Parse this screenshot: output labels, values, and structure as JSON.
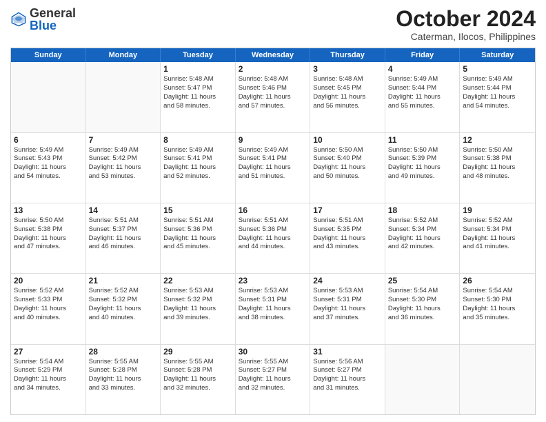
{
  "logo": {
    "general": "General",
    "blue": "Blue"
  },
  "title": "October 2024",
  "subtitle": "Caterman, Ilocos, Philippines",
  "header_days": [
    "Sunday",
    "Monday",
    "Tuesday",
    "Wednesday",
    "Thursday",
    "Friday",
    "Saturday"
  ],
  "weeks": [
    [
      {
        "day": "",
        "sunrise": "",
        "sunset": "",
        "daylight": "",
        "empty": true
      },
      {
        "day": "",
        "sunrise": "",
        "sunset": "",
        "daylight": "",
        "empty": true
      },
      {
        "day": "1",
        "sunrise": "Sunrise: 5:48 AM",
        "sunset": "Sunset: 5:47 PM",
        "daylight": "Daylight: 11 hours",
        "daylight2": "and 58 minutes.",
        "empty": false
      },
      {
        "day": "2",
        "sunrise": "Sunrise: 5:48 AM",
        "sunset": "Sunset: 5:46 PM",
        "daylight": "Daylight: 11 hours",
        "daylight2": "and 57 minutes.",
        "empty": false
      },
      {
        "day": "3",
        "sunrise": "Sunrise: 5:48 AM",
        "sunset": "Sunset: 5:45 PM",
        "daylight": "Daylight: 11 hours",
        "daylight2": "and 56 minutes.",
        "empty": false
      },
      {
        "day": "4",
        "sunrise": "Sunrise: 5:49 AM",
        "sunset": "Sunset: 5:44 PM",
        "daylight": "Daylight: 11 hours",
        "daylight2": "and 55 minutes.",
        "empty": false
      },
      {
        "day": "5",
        "sunrise": "Sunrise: 5:49 AM",
        "sunset": "Sunset: 5:44 PM",
        "daylight": "Daylight: 11 hours",
        "daylight2": "and 54 minutes.",
        "empty": false
      }
    ],
    [
      {
        "day": "6",
        "sunrise": "Sunrise: 5:49 AM",
        "sunset": "Sunset: 5:43 PM",
        "daylight": "Daylight: 11 hours",
        "daylight2": "and 54 minutes.",
        "empty": false
      },
      {
        "day": "7",
        "sunrise": "Sunrise: 5:49 AM",
        "sunset": "Sunset: 5:42 PM",
        "daylight": "Daylight: 11 hours",
        "daylight2": "and 53 minutes.",
        "empty": false
      },
      {
        "day": "8",
        "sunrise": "Sunrise: 5:49 AM",
        "sunset": "Sunset: 5:41 PM",
        "daylight": "Daylight: 11 hours",
        "daylight2": "and 52 minutes.",
        "empty": false
      },
      {
        "day": "9",
        "sunrise": "Sunrise: 5:49 AM",
        "sunset": "Sunset: 5:41 PM",
        "daylight": "Daylight: 11 hours",
        "daylight2": "and 51 minutes.",
        "empty": false
      },
      {
        "day": "10",
        "sunrise": "Sunrise: 5:50 AM",
        "sunset": "Sunset: 5:40 PM",
        "daylight": "Daylight: 11 hours",
        "daylight2": "and 50 minutes.",
        "empty": false
      },
      {
        "day": "11",
        "sunrise": "Sunrise: 5:50 AM",
        "sunset": "Sunset: 5:39 PM",
        "daylight": "Daylight: 11 hours",
        "daylight2": "and 49 minutes.",
        "empty": false
      },
      {
        "day": "12",
        "sunrise": "Sunrise: 5:50 AM",
        "sunset": "Sunset: 5:38 PM",
        "daylight": "Daylight: 11 hours",
        "daylight2": "and 48 minutes.",
        "empty": false
      }
    ],
    [
      {
        "day": "13",
        "sunrise": "Sunrise: 5:50 AM",
        "sunset": "Sunset: 5:38 PM",
        "daylight": "Daylight: 11 hours",
        "daylight2": "and 47 minutes.",
        "empty": false
      },
      {
        "day": "14",
        "sunrise": "Sunrise: 5:51 AM",
        "sunset": "Sunset: 5:37 PM",
        "daylight": "Daylight: 11 hours",
        "daylight2": "and 46 minutes.",
        "empty": false
      },
      {
        "day": "15",
        "sunrise": "Sunrise: 5:51 AM",
        "sunset": "Sunset: 5:36 PM",
        "daylight": "Daylight: 11 hours",
        "daylight2": "and 45 minutes.",
        "empty": false
      },
      {
        "day": "16",
        "sunrise": "Sunrise: 5:51 AM",
        "sunset": "Sunset: 5:36 PM",
        "daylight": "Daylight: 11 hours",
        "daylight2": "and 44 minutes.",
        "empty": false
      },
      {
        "day": "17",
        "sunrise": "Sunrise: 5:51 AM",
        "sunset": "Sunset: 5:35 PM",
        "daylight": "Daylight: 11 hours",
        "daylight2": "and 43 minutes.",
        "empty": false
      },
      {
        "day": "18",
        "sunrise": "Sunrise: 5:52 AM",
        "sunset": "Sunset: 5:34 PM",
        "daylight": "Daylight: 11 hours",
        "daylight2": "and 42 minutes.",
        "empty": false
      },
      {
        "day": "19",
        "sunrise": "Sunrise: 5:52 AM",
        "sunset": "Sunset: 5:34 PM",
        "daylight": "Daylight: 11 hours",
        "daylight2": "and 41 minutes.",
        "empty": false
      }
    ],
    [
      {
        "day": "20",
        "sunrise": "Sunrise: 5:52 AM",
        "sunset": "Sunset: 5:33 PM",
        "daylight": "Daylight: 11 hours",
        "daylight2": "and 40 minutes.",
        "empty": false
      },
      {
        "day": "21",
        "sunrise": "Sunrise: 5:52 AM",
        "sunset": "Sunset: 5:32 PM",
        "daylight": "Daylight: 11 hours",
        "daylight2": "and 40 minutes.",
        "empty": false
      },
      {
        "day": "22",
        "sunrise": "Sunrise: 5:53 AM",
        "sunset": "Sunset: 5:32 PM",
        "daylight": "Daylight: 11 hours",
        "daylight2": "and 39 minutes.",
        "empty": false
      },
      {
        "day": "23",
        "sunrise": "Sunrise: 5:53 AM",
        "sunset": "Sunset: 5:31 PM",
        "daylight": "Daylight: 11 hours",
        "daylight2": "and 38 minutes.",
        "empty": false
      },
      {
        "day": "24",
        "sunrise": "Sunrise: 5:53 AM",
        "sunset": "Sunset: 5:31 PM",
        "daylight": "Daylight: 11 hours",
        "daylight2": "and 37 minutes.",
        "empty": false
      },
      {
        "day": "25",
        "sunrise": "Sunrise: 5:54 AM",
        "sunset": "Sunset: 5:30 PM",
        "daylight": "Daylight: 11 hours",
        "daylight2": "and 36 minutes.",
        "empty": false
      },
      {
        "day": "26",
        "sunrise": "Sunrise: 5:54 AM",
        "sunset": "Sunset: 5:30 PM",
        "daylight": "Daylight: 11 hours",
        "daylight2": "and 35 minutes.",
        "empty": false
      }
    ],
    [
      {
        "day": "27",
        "sunrise": "Sunrise: 5:54 AM",
        "sunset": "Sunset: 5:29 PM",
        "daylight": "Daylight: 11 hours",
        "daylight2": "and 34 minutes.",
        "empty": false
      },
      {
        "day": "28",
        "sunrise": "Sunrise: 5:55 AM",
        "sunset": "Sunset: 5:28 PM",
        "daylight": "Daylight: 11 hours",
        "daylight2": "and 33 minutes.",
        "empty": false
      },
      {
        "day": "29",
        "sunrise": "Sunrise: 5:55 AM",
        "sunset": "Sunset: 5:28 PM",
        "daylight": "Daylight: 11 hours",
        "daylight2": "and 32 minutes.",
        "empty": false
      },
      {
        "day": "30",
        "sunrise": "Sunrise: 5:55 AM",
        "sunset": "Sunset: 5:27 PM",
        "daylight": "Daylight: 11 hours",
        "daylight2": "and 32 minutes.",
        "empty": false
      },
      {
        "day": "31",
        "sunrise": "Sunrise: 5:56 AM",
        "sunset": "Sunset: 5:27 PM",
        "daylight": "Daylight: 11 hours",
        "daylight2": "and 31 minutes.",
        "empty": false
      },
      {
        "day": "",
        "sunrise": "",
        "sunset": "",
        "daylight": "",
        "daylight2": "",
        "empty": true
      },
      {
        "day": "",
        "sunrise": "",
        "sunset": "",
        "daylight": "",
        "daylight2": "",
        "empty": true
      }
    ]
  ]
}
